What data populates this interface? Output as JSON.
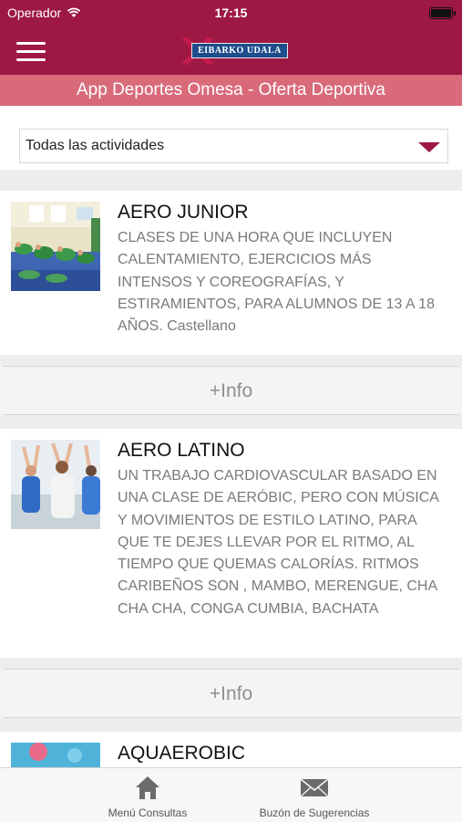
{
  "status_bar": {
    "carrier": "Operador",
    "time": "17:15"
  },
  "header": {
    "logo_text": "EIBARKO UDALA",
    "subtitle": "App Deportes Omesa - Oferta Deportiva"
  },
  "filter": {
    "selected": "Todas las actividades"
  },
  "activities": [
    {
      "title": "AERO JUNIOR",
      "description": "CLASES DE UNA HORA QUE INCLUYEN CALENTAMIENTO, EJERCICIOS MÁS INTENSOS Y COREOGRAFÍAS, Y ESTIRAMIENTOS, PARA ALUMNOS DE 13 A 18 AÑOS. Castellano",
      "info_label": "+Info"
    },
    {
      "title": "AERO LATINO",
      "description": "UN TRABAJO CARDIOVASCULAR BASADO EN UNA CLASE DE AERÓBIC, PERO CON MÚSICA Y MOVIMIENTOS DE ESTILO LATINO, PARA QUE TE DEJES LLEVAR POR EL RITMO, AL TIEMPO QUE QUEMAS CALORÍAS. RITMOS CARIBEÑOS SON , MAMBO, MERENGUE, CHA CHA CHA, CONGA CUMBIA, BACHATA",
      "info_label": "+Info"
    },
    {
      "title": "AQUAEROBIC"
    }
  ],
  "tab_bar": [
    {
      "label": "Menú Consultas",
      "icon": "home-icon"
    },
    {
      "label": "Buzón de Sugerencias",
      "icon": "mail-icon"
    }
  ],
  "colors": {
    "primary": "#9e1844",
    "subheader": "#d86a7a",
    "logo_blue": "#1e4e8c"
  }
}
